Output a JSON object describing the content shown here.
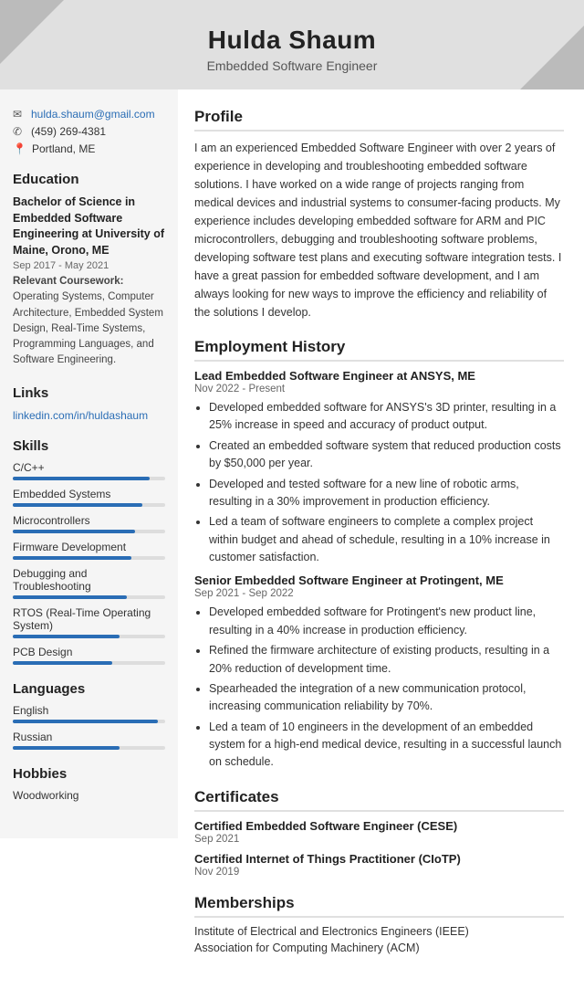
{
  "header": {
    "name": "Hulda Shaum",
    "title": "Embedded Software Engineer"
  },
  "sidebar": {
    "contact": {
      "email": "hulda.shaum@gmail.com",
      "phone": "(459) 269-4381",
      "location": "Portland, ME"
    },
    "education": {
      "section_title": "Education",
      "degree": "Bachelor of Science in Embedded Software Engineering at University of Maine, Orono, ME",
      "date": "Sep 2017 - May 2021",
      "courses_label": "Relevant Coursework:",
      "courses": "Operating Systems, Computer Architecture, Embedded System Design, Real-Time Systems, Programming Languages, and Software Engineering."
    },
    "links": {
      "section_title": "Links",
      "url_text": "linkedin.com/in/huldashaum",
      "url": "#"
    },
    "skills": {
      "section_title": "Skills",
      "items": [
        {
          "name": "C/C++",
          "pct": 90
        },
        {
          "name": "Embedded Systems",
          "pct": 85
        },
        {
          "name": "Microcontrollers",
          "pct": 80
        },
        {
          "name": "Firmware Development",
          "pct": 78
        },
        {
          "name": "Debugging and Troubleshooting",
          "pct": 75
        },
        {
          "name": "RTOS (Real-Time Operating System)",
          "pct": 70
        },
        {
          "name": "PCB Design",
          "pct": 65
        }
      ]
    },
    "languages": {
      "section_title": "Languages",
      "items": [
        {
          "name": "English",
          "pct": 95
        },
        {
          "name": "Russian",
          "pct": 70
        }
      ]
    },
    "hobbies": {
      "section_title": "Hobbies",
      "text": "Woodworking"
    }
  },
  "content": {
    "profile": {
      "section_title": "Profile",
      "text": "I am an experienced Embedded Software Engineer with over 2 years of experience in developing and troubleshooting embedded software solutions. I have worked on a wide range of projects ranging from medical devices and industrial systems to consumer-facing products. My experience includes developing embedded software for ARM and PIC microcontrollers, debugging and troubleshooting software problems, developing software test plans and executing software integration tests. I have a great passion for embedded software development, and I am always looking for new ways to improve the efficiency and reliability of the solutions I develop."
    },
    "employment": {
      "section_title": "Employment History",
      "jobs": [
        {
          "title": "Lead Embedded Software Engineer at ANSYS, ME",
          "date": "Nov 2022 - Present",
          "bullets": [
            "Developed embedded software for ANSYS's 3D printer, resulting in a 25% increase in speed and accuracy of product output.",
            "Created an embedded software system that reduced production costs by $50,000 per year.",
            "Developed and tested software for a new line of robotic arms, resulting in a 30% improvement in production efficiency.",
            "Led a team of software engineers to complete a complex project within budget and ahead of schedule, resulting in a 10% increase in customer satisfaction."
          ]
        },
        {
          "title": "Senior Embedded Software Engineer at Protingent, ME",
          "date": "Sep 2021 - Sep 2022",
          "bullets": [
            "Developed embedded software for Protingent's new product line, resulting in a 40% increase in production efficiency.",
            "Refined the firmware architecture of existing products, resulting in a 20% reduction of development time.",
            "Spearheaded the integration of a new communication protocol, increasing communication reliability by 70%.",
            "Led a team of 10 engineers in the development of an embedded system for a high-end medical device, resulting in a successful launch on schedule."
          ]
        }
      ]
    },
    "certificates": {
      "section_title": "Certificates",
      "items": [
        {
          "name": "Certified Embedded Software Engineer (CESE)",
          "date": "Sep 2021"
        },
        {
          "name": "Certified Internet of Things Practitioner (CIoTP)",
          "date": "Nov 2019"
        }
      ]
    },
    "memberships": {
      "section_title": "Memberships",
      "items": [
        "Institute of Electrical and Electronics Engineers (IEEE)",
        "Association for Computing Machinery (ACM)"
      ]
    }
  }
}
